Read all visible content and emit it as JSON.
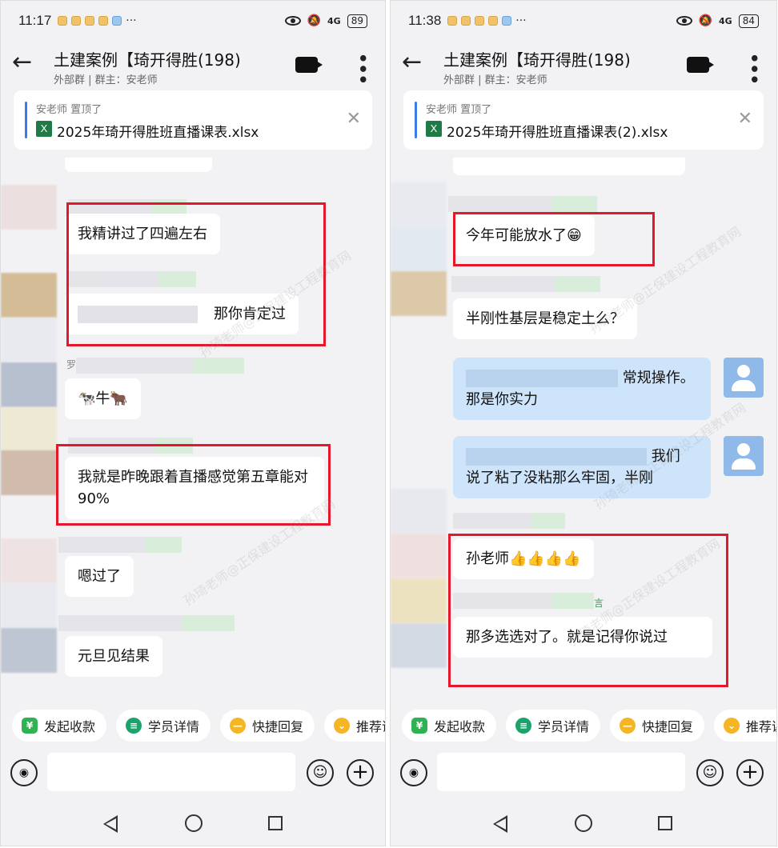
{
  "left": {
    "status": {
      "time": "11:17",
      "ellipsis": "···",
      "network": "4G",
      "battery": "89"
    },
    "header": {
      "title": "土建案例【琦开得胜(198)",
      "subtitle": "外部群 | 群主：安老师"
    },
    "pinned": {
      "by": "安老师 置顶了",
      "file": "2025年琦开得胜班直播课表.xlsx",
      "icon": "X"
    },
    "messages": {
      "m1": "我精讲过了四遍左右",
      "m2": "那你肯定过",
      "m3_name": "罗",
      "m3": "🐄牛🐂",
      "m4": "我就是昨晚跟着直播感觉第五章能对90%",
      "m5": "嗯过了",
      "m6": "元旦见结果"
    }
  },
  "right": {
    "status": {
      "time": "11:38",
      "ellipsis": "···",
      "network": "4G",
      "battery": "84"
    },
    "header": {
      "title": "土建案例【琦开得胜(198)",
      "subtitle": "外部群 | 群主：安老师"
    },
    "pinned": {
      "by": "安老师 置顶了",
      "file": "2025年琦开得胜班直播课表(2).xlsx",
      "icon": "X"
    },
    "messages": {
      "m1": "今年可能放水了😁",
      "m2": "半刚性基层是稳定土么？",
      "me1_a": "常规操作。",
      "me1_b": "那是你实力",
      "me2_a": "我们",
      "me2_b": "说了粘了没粘那么牢固，半刚",
      "m3": "孙老师👍👍👍👍",
      "m4_tag": "言",
      "m4": "那多选选对了。就是记得你说过"
    }
  },
  "quickbar": [
    "发起收款",
    "学员详情",
    "快捷回复",
    "推荐课"
  ],
  "watermark": "孙琦老师@正保建设工程教育网"
}
